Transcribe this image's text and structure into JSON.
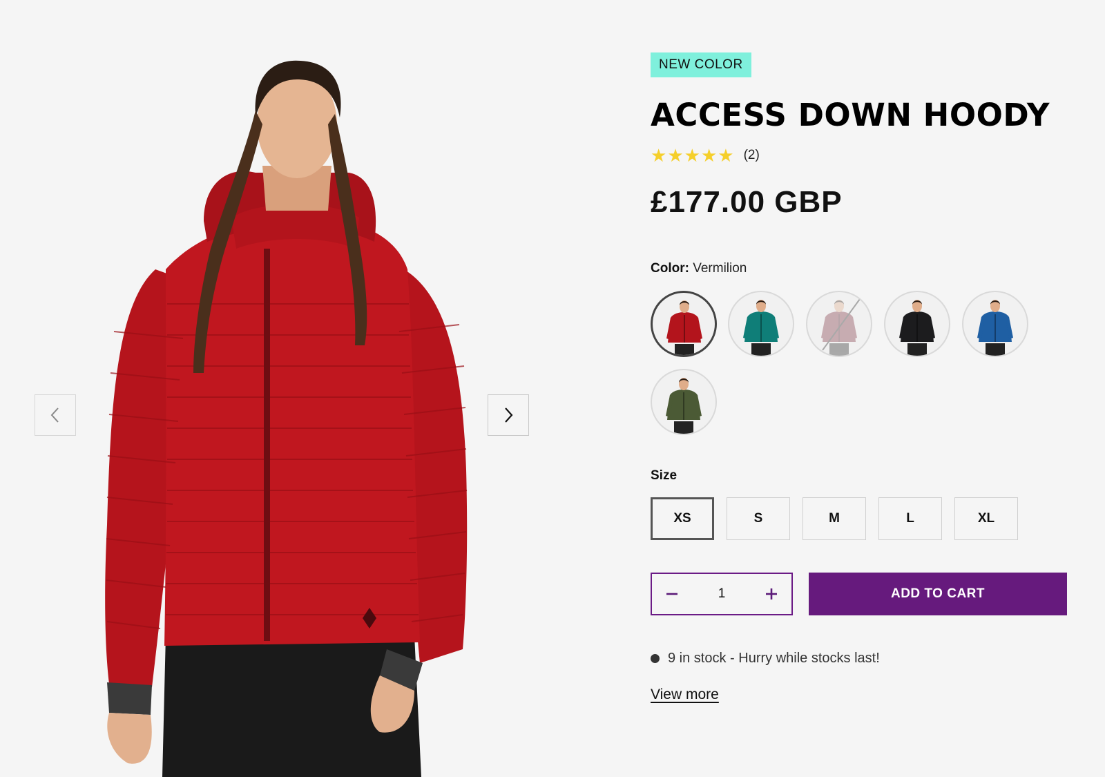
{
  "product": {
    "badge": "NEW COLOR",
    "title": "ACCESS DOWN HOODY",
    "rating": {
      "stars": 5,
      "max": 5,
      "review_count": "(2)"
    },
    "price": "£177.00 GBP",
    "color": {
      "label": "Color:",
      "selected": "Vermilion"
    },
    "swatches": [
      {
        "name": "vermilion",
        "jacket": "#b3141c",
        "selected": true,
        "available": true
      },
      {
        "name": "teal",
        "jacket": "#0f7e78",
        "selected": false,
        "available": true
      },
      {
        "name": "burgundy",
        "jacket": "#7a2b3a",
        "selected": false,
        "available": false
      },
      {
        "name": "black",
        "jacket": "#1c1c1e",
        "selected": false,
        "available": true
      },
      {
        "name": "blue",
        "jacket": "#1f5fa3",
        "selected": false,
        "available": true
      },
      {
        "name": "olive",
        "jacket": "#4b5a35",
        "selected": false,
        "available": true
      }
    ],
    "size": {
      "label": "Size",
      "options": [
        "XS",
        "S",
        "M",
        "L",
        "XL"
      ],
      "selected": "XS"
    },
    "quantity": "1",
    "add_to_cart": "ADD TO CART",
    "stock_message": "9 in stock - Hurry while stocks last!",
    "view_more": "View more"
  },
  "colors": {
    "background": "#f5f5f5",
    "badge": "#7ff0dc",
    "accent": "#661a7d",
    "star": "#f5cf2b",
    "jacket_main": "#c0171f"
  },
  "icons": {
    "prev": "chevron-left-icon",
    "next": "chevron-right-icon",
    "minus": "minus-icon",
    "plus": "plus-icon",
    "star": "star-icon"
  }
}
